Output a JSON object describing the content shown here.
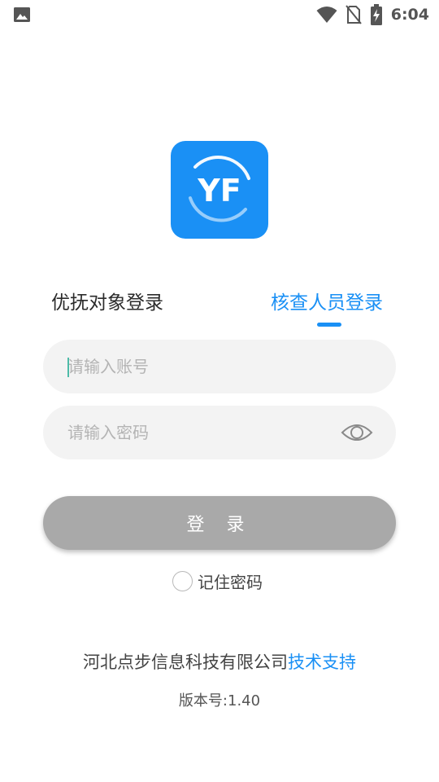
{
  "status_bar": {
    "time": "6:04",
    "icons": [
      "image-icon",
      "wifi-icon",
      "no-sim-icon",
      "battery-charging-icon"
    ]
  },
  "logo": {
    "text": "YF",
    "icon": "app-logo-icon",
    "color": "#1a90f5"
  },
  "tabs": [
    {
      "label": "优抚对象登录",
      "active": false
    },
    {
      "label": "核查人员登录",
      "active": true
    }
  ],
  "form": {
    "account_placeholder": "请输入账号",
    "password_placeholder": "请输入密码",
    "account_value": "",
    "password_value": ""
  },
  "login_button": {
    "label": "登 录"
  },
  "remember": {
    "label": "记住密码",
    "checked": false
  },
  "footer": {
    "company": "河北点步信息科技有限公司",
    "support": "技术支持",
    "version": "版本号:1.40"
  },
  "colors": {
    "accent": "#1a90f5",
    "button_disabled": "#a9a9a9",
    "input_bg": "#f3f3f3"
  }
}
